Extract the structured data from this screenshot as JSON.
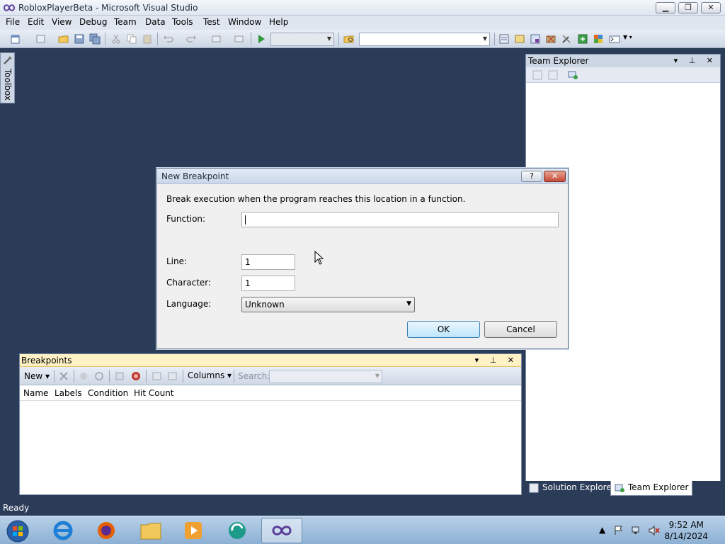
{
  "window": {
    "title": "RobloxPlayerBeta - Microsoft Visual Studio",
    "controls": {
      "minimize": "▁",
      "restore": "❐",
      "close": "✕"
    }
  },
  "menubar": {
    "items": [
      {
        "label": "File"
      },
      {
        "label": "Edit"
      },
      {
        "label": "View"
      },
      {
        "label": "Debug"
      },
      {
        "label": "Team"
      },
      {
        "label": "Data"
      },
      {
        "label": "Tools"
      },
      {
        "label": "Test"
      },
      {
        "label": "Window"
      },
      {
        "label": "Help"
      }
    ]
  },
  "toolbox": {
    "label": "Toolbox"
  },
  "team_explorer": {
    "title": "Team Explorer",
    "controls": "▾ ⊥ ✕"
  },
  "dialog": {
    "title": "New Breakpoint",
    "help_label": "?",
    "close_label": "✕",
    "description": "Break execution when the program reaches this location in a function.",
    "function_label": "Function:",
    "function_value": "",
    "line_label": "Line:",
    "line_value": "1",
    "character_label": "Character:",
    "character_value": "1",
    "language_label": "Language:",
    "language_value": "Unknown",
    "ok_label": "OK",
    "cancel_label": "Cancel"
  },
  "breakpoints": {
    "title": "Breakpoints",
    "controls": "▾ ⊥ ✕",
    "new_label": "New ▾",
    "columns_label": "Columns ▾",
    "search_label": "Search:",
    "columns": [
      {
        "label": "Name"
      },
      {
        "label": "Labels"
      },
      {
        "label": "Condition"
      },
      {
        "label": "Hit Count"
      }
    ]
  },
  "bottom_tabs": {
    "solution_explorer": "Solution Explorer",
    "team_explorer": "Team Explorer"
  },
  "status": {
    "text": "Ready"
  },
  "taskbar": {
    "time": "9:52 AM",
    "date": "8/14/2024"
  },
  "colors": {
    "ide_background": "#2b3c59",
    "breakpoints_header": "#fff2c5",
    "dialog_background": "#f0f0f0",
    "close_button": "#c54a36"
  }
}
